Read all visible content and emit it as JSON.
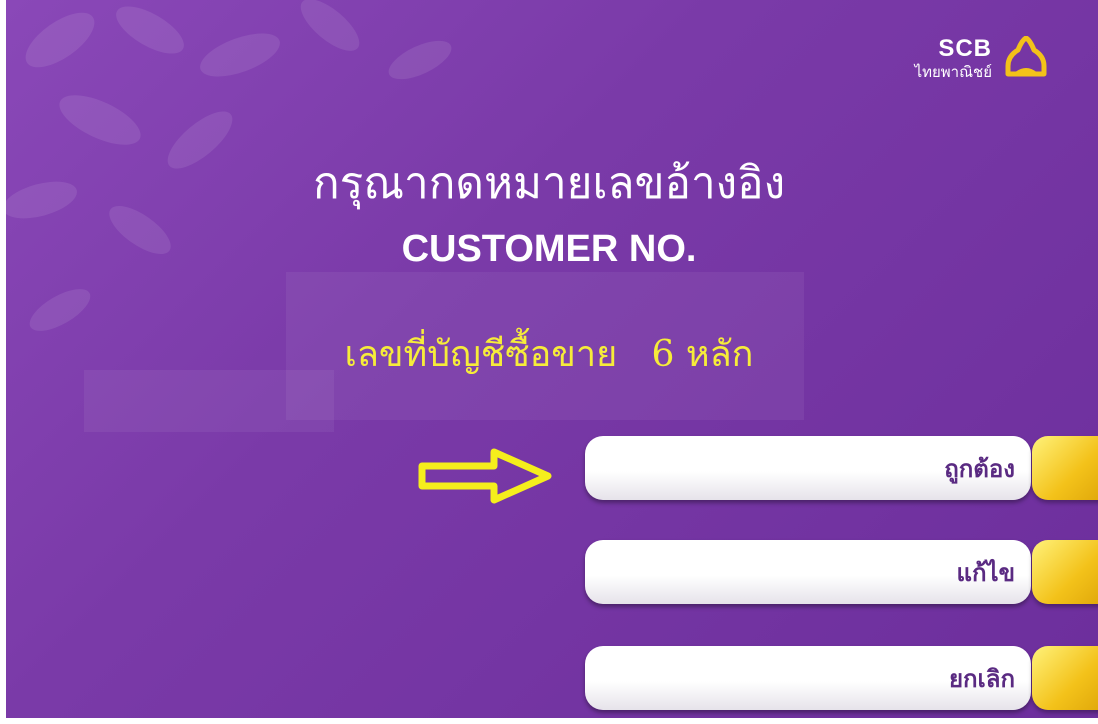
{
  "logo": {
    "brand_en": "SCB",
    "brand_th": "ไทยพาณิชย์",
    "icon": "scb-bell-icon"
  },
  "screen": {
    "title_th": "กรุณากดหมายเลขอ้างอิง",
    "title_en": "CUSTOMER NO.",
    "subtitle": "เลขที่บัญชีซื้อขาย   6 หลัก",
    "pointer_icon": "arrow-right-icon"
  },
  "buttons": [
    {
      "label": "ถูกต้อง"
    },
    {
      "label": "แก้ไข"
    },
    {
      "label": "ยกเลิก"
    }
  ],
  "colors": {
    "background": "#7a3aa8",
    "subtitle": "#f6ec3a",
    "button_text": "#5a2a82",
    "side_key": "#f3c21a"
  }
}
